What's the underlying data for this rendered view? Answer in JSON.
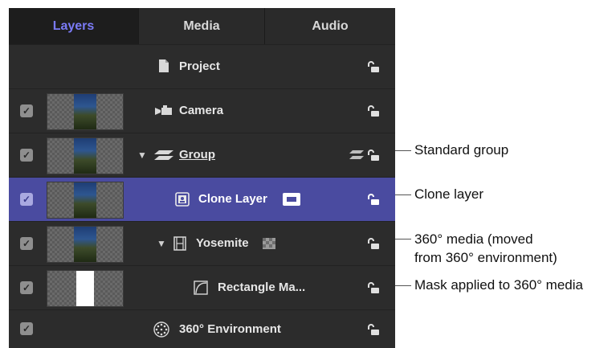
{
  "tabs": [
    {
      "label": "Layers",
      "active": true
    },
    {
      "label": "Media",
      "active": false
    },
    {
      "label": "Audio",
      "active": false
    }
  ],
  "rows": [
    {
      "label": "Project",
      "checkbox": false,
      "thumbnail": "none",
      "icon": "document-icon"
    },
    {
      "label": "Camera",
      "checkbox": true,
      "thumbnail": "photo",
      "icon": "camera-icon"
    },
    {
      "label": "Group",
      "checkbox": true,
      "thumbnail": "photo",
      "icon": "group-icon",
      "expanded": true
    },
    {
      "label": "Clone Layer",
      "checkbox": true,
      "thumbnail": "photo",
      "icon": "clone-layer-icon",
      "selected": true
    },
    {
      "label": "Yosemite",
      "checkbox": true,
      "thumbnail": "photo",
      "icon": "film-icon",
      "expanded": true
    },
    {
      "label": "Rectangle Ma...",
      "checkbox": true,
      "thumbnail": "white-mask",
      "icon": "mask-icon"
    },
    {
      "label": "360° Environment",
      "checkbox": true,
      "thumbnail": "none",
      "icon": "360-environment-icon"
    }
  ],
  "callouts": {
    "standard_group": "Standard group",
    "clone_layer": "Clone layer",
    "media_360_line1": "360° media (moved",
    "media_360_line2": "from 360° environment)",
    "mask": "Mask applied to 360° media"
  },
  "colors": {
    "accent_tab": "#7b7bf7",
    "selected_row": "#4a4ba0",
    "panel_bg": "#2c2c2c"
  }
}
